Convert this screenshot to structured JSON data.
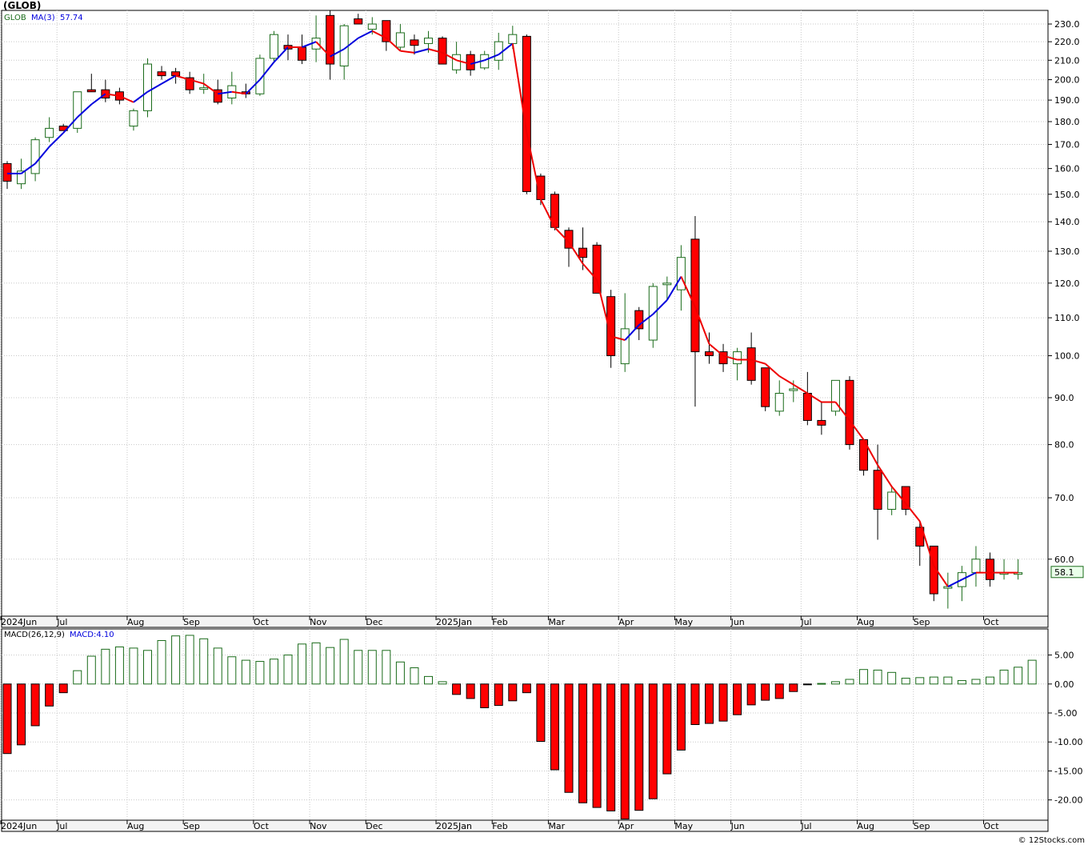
{
  "window_title": "(GLOB)",
  "footer": "© 12Stocks.com",
  "colors": {
    "up": "#1a6b1a",
    "down": "#ff0000",
    "ma_up": "#0000dd",
    "ma_down": "#ee0000",
    "grid": "#c8c8c8"
  },
  "chart_data": [
    {
      "type": "candlestick",
      "symbol": "GLOB",
      "legend": {
        "symbol": "GLOB",
        "ma_label": "MA(3)",
        "ma_value": "57.74"
      },
      "price_scale": "log",
      "last_price_label": "58.1",
      "ylim": [
        52,
        238
      ],
      "y_ticks": [
        60,
        70,
        80,
        90,
        100,
        110,
        120,
        130,
        140,
        150,
        160,
        170,
        180,
        190,
        200,
        210,
        220,
        230
      ],
      "y_tick_labels": [
        "60.0",
        "70.0",
        "80.0",
        "90.0",
        "100.0",
        "110.0",
        "120.0",
        "130.0",
        "140.0",
        "150.0",
        "160.0",
        "170.0",
        "180.0",
        "190.0",
        "200.0",
        "210.0",
        "220.0",
        "230.0"
      ],
      "x_labels": [
        {
          "text": "2024Jun",
          "week": 0
        },
        {
          "text": "Jul",
          "week": 4
        },
        {
          "text": "Aug",
          "week": 9
        },
        {
          "text": "Sep",
          "week": 13
        },
        {
          "text": "Oct",
          "week": 18
        },
        {
          "text": "Nov",
          "week": 22
        },
        {
          "text": "Dec",
          "week": 26
        },
        {
          "text": "2025Jan",
          "week": 31
        },
        {
          "text": "Feb",
          "week": 35
        },
        {
          "text": "Mar",
          "week": 39
        },
        {
          "text": "Apr",
          "week": 44
        },
        {
          "text": "May",
          "week": 48
        },
        {
          "text": "Jun",
          "week": 52
        },
        {
          "text": "Jul",
          "week": 57
        },
        {
          "text": "Aug",
          "week": 61
        },
        {
          "text": "Sep",
          "week": 65
        },
        {
          "text": "Oct",
          "week": 70
        }
      ],
      "candles": [
        [
          162,
          163,
          152,
          155
        ],
        [
          154,
          164,
          152,
          159
        ],
        [
          158,
          173,
          155,
          172
        ],
        [
          173,
          182,
          171,
          177
        ],
        [
          178,
          179,
          176,
          176
        ],
        [
          177,
          194,
          175,
          194
        ],
        [
          195,
          203,
          194,
          194
        ],
        [
          195,
          200,
          189,
          191
        ],
        [
          194,
          196,
          188,
          190
        ],
        [
          178,
          186,
          176,
          185
        ],
        [
          185,
          211,
          182,
          208
        ],
        [
          204,
          207,
          200,
          202
        ],
        [
          204,
          206,
          198,
          202
        ],
        [
          201,
          204,
          193,
          195
        ],
        [
          196,
          203,
          193,
          196
        ],
        [
          195,
          200,
          188,
          189
        ],
        [
          191,
          204,
          188,
          197
        ],
        [
          194,
          198,
          191,
          193
        ],
        [
          193,
          213,
          192,
          211
        ],
        [
          211,
          226,
          209,
          224
        ],
        [
          218,
          224,
          210,
          216
        ],
        [
          217,
          224,
          208,
          210
        ],
        [
          216,
          235,
          209,
          222
        ],
        [
          235,
          238,
          200,
          208
        ],
        [
          207,
          230,
          200,
          229
        ],
        [
          233,
          236,
          230,
          230
        ],
        [
          227,
          234,
          224,
          230
        ],
        [
          232,
          232,
          215,
          220
        ],
        [
          217,
          230,
          215,
          225
        ],
        [
          221,
          224,
          213,
          218
        ],
        [
          219,
          226,
          214,
          222
        ],
        [
          222,
          223,
          212,
          208
        ],
        [
          205,
          220,
          203,
          213
        ],
        [
          213,
          215,
          202,
          205
        ],
        [
          206,
          215,
          205,
          213
        ],
        [
          210,
          225,
          205,
          220
        ],
        [
          219,
          229,
          216,
          224
        ],
        [
          223,
          224,
          150,
          151
        ],
        [
          157,
          158,
          146,
          148
        ],
        [
          150,
          151,
          137,
          138
        ],
        [
          137,
          138,
          125,
          131
        ],
        [
          131,
          138,
          124,
          128
        ],
        [
          132,
          133,
          117,
          117
        ],
        [
          116,
          118,
          97,
          100
        ],
        [
          98,
          117,
          96,
          107
        ],
        [
          112,
          113,
          104,
          107
        ],
        [
          104,
          120,
          102,
          119
        ],
        [
          120,
          122,
          115,
          120
        ],
        [
          118,
          132,
          112,
          128
        ],
        [
          134,
          142,
          88,
          101
        ],
        [
          101,
          106,
          98,
          100
        ],
        [
          101,
          103,
          96,
          98
        ],
        [
          98,
          102,
          94,
          101
        ],
        [
          102,
          106,
          93,
          94
        ],
        [
          97,
          97,
          87,
          88
        ],
        [
          87,
          94,
          86,
          91
        ],
        [
          92,
          94,
          89,
          92
        ],
        [
          91,
          96,
          84,
          85
        ],
        [
          85,
          89,
          82,
          84
        ],
        [
          87,
          94,
          86,
          94
        ],
        [
          94,
          95,
          79,
          80
        ],
        [
          81,
          81,
          74,
          75
        ],
        [
          75,
          80,
          63,
          68
        ],
        [
          68,
          72,
          67,
          71
        ],
        [
          72,
          72,
          67,
          68
        ],
        [
          65,
          66,
          59,
          62
        ],
        [
          62,
          62,
          54,
          55
        ],
        [
          56,
          58,
          53,
          56
        ],
        [
          56,
          59,
          54,
          58
        ],
        [
          58,
          62,
          56,
          60
        ],
        [
          60,
          61,
          56,
          57
        ],
        [
          58,
          60,
          57,
          58
        ],
        [
          58,
          60,
          57,
          58
        ]
      ],
      "ma3": [
        158,
        158,
        162,
        169,
        175,
        182,
        188,
        193,
        192,
        189,
        194,
        198,
        202,
        200,
        198,
        193,
        194,
        193,
        200,
        209,
        217,
        217,
        220,
        212,
        216,
        222,
        226,
        222,
        215,
        214,
        216,
        214,
        210,
        208,
        210,
        213,
        219,
        175,
        148,
        138,
        133,
        126,
        121,
        105,
        104,
        108,
        111,
        115,
        122,
        113,
        103,
        100,
        99,
        99,
        98,
        95,
        93,
        91,
        89,
        89,
        85,
        81,
        76,
        72,
        69,
        66,
        59,
        56,
        57,
        58,
        58,
        58,
        58
      ],
      "ma3_down_segments_from": [
        8,
        21,
        27,
        36,
        48,
        52,
        66
      ]
    },
    {
      "type": "bar",
      "indicator": "MACD",
      "legend": {
        "params": "MACD(26,12,9)",
        "value_label": "MACD:4.10"
      },
      "ylim": [
        -23.5,
        9.5
      ],
      "y_ticks": [
        5,
        0,
        -5,
        -10,
        -15,
        -20
      ],
      "y_tick_labels": [
        "5.00",
        "0.00",
        "-5.00",
        "-10.00",
        "-15.00",
        "-20.00"
      ],
      "values": [
        -12.0,
        -10.5,
        -7.2,
        -3.8,
        -1.5,
        2.3,
        4.8,
        6.0,
        6.4,
        6.2,
        5.8,
        7.5,
        8.3,
        8.4,
        7.8,
        6.2,
        4.7,
        4.1,
        3.9,
        4.3,
        5.0,
        6.9,
        7.1,
        6.3,
        7.7,
        5.8,
        5.8,
        5.8,
        3.8,
        2.8,
        1.3,
        0.4,
        -1.8,
        -2.5,
        -4.1,
        -3.7,
        -2.9,
        -1.5,
        -9.9,
        -14.8,
        -18.7,
        -20.5,
        -21.3,
        -21.9,
        -23.3,
        -21.8,
        -19.8,
        -15.5,
        -11.4,
        -7.0,
        -6.8,
        -6.4,
        -5.3,
        -3.6,
        -2.8,
        -2.5,
        -1.3,
        -0.1,
        0.1,
        0.4,
        0.8,
        2.5,
        2.4,
        2.0,
        1.0,
        1.1,
        1.2,
        1.2,
        0.6,
        0.8,
        1.2,
        2.4,
        2.9,
        4.1
      ]
    }
  ]
}
